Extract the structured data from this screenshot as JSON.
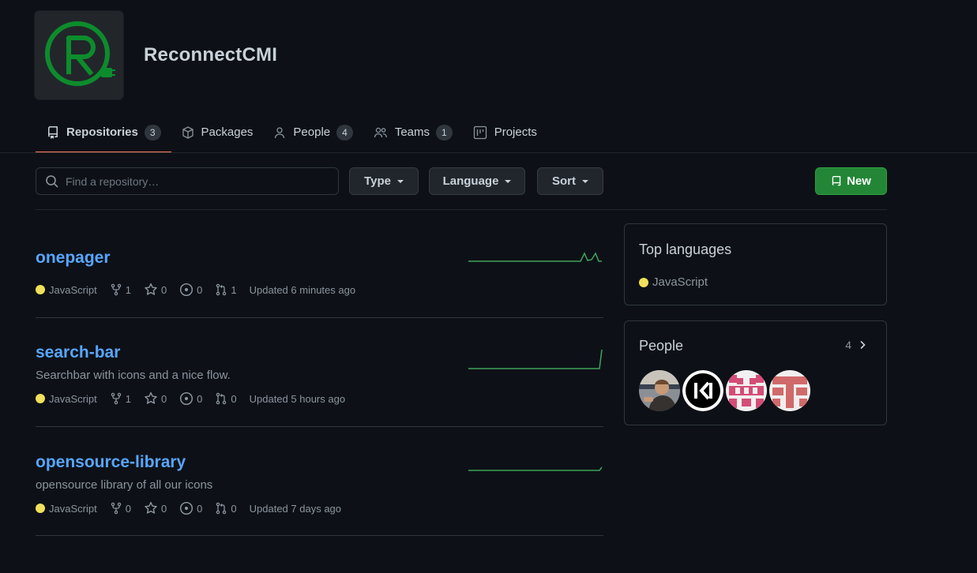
{
  "org": {
    "name": "ReconnectCMI",
    "logo_icon": "reconnect-logo-r-plug"
  },
  "tabs": [
    {
      "label": "Repositories",
      "count": "3",
      "icon": "repo-icon"
    },
    {
      "label": "Packages",
      "count": null,
      "icon": "package-icon"
    },
    {
      "label": "People",
      "count": "4",
      "icon": "person-icon"
    },
    {
      "label": "Teams",
      "count": "1",
      "icon": "people-icon"
    },
    {
      "label": "Projects",
      "count": null,
      "icon": "project-icon"
    }
  ],
  "filters": {
    "search_placeholder": "Find a repository…",
    "type_label": "Type",
    "language_label": "Language",
    "sort_label": "Sort",
    "new_label": "New"
  },
  "repos": [
    {
      "name": "onepager",
      "description": "",
      "language": "JavaScript",
      "forks": "1",
      "stars": "0",
      "issues": "0",
      "pulls": "1",
      "updated": "Updated 6 minutes ago"
    },
    {
      "name": "search-bar",
      "description": "Searchbar with icons and a nice flow.",
      "language": "JavaScript",
      "forks": "1",
      "stars": "0",
      "issues": "0",
      "pulls": "0",
      "updated": "Updated 5 hours ago"
    },
    {
      "name": "opensource-library",
      "description": "opensource library of all our icons",
      "language": "JavaScript",
      "forks": "0",
      "stars": "0",
      "issues": "0",
      "pulls": "0",
      "updated": "Updated 7 days ago"
    }
  ],
  "sidebar": {
    "top_languages_title": "Top languages",
    "top_language": "JavaScript",
    "people_title": "People",
    "people_count": "4"
  },
  "colors": {
    "accent_link": "#58a6ff",
    "javascript": "#f1e05a",
    "new_button": "#238636",
    "tab_underline": "#f78166"
  }
}
